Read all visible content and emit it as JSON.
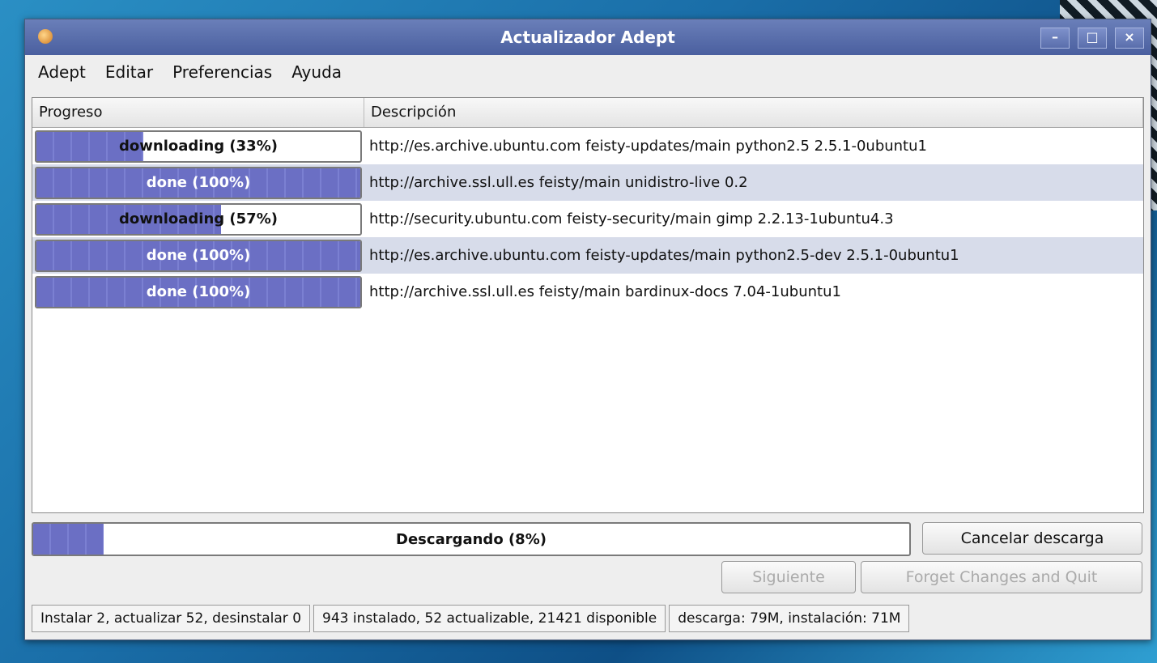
{
  "window": {
    "title": "Actualizador Adept"
  },
  "menu": [
    {
      "label": "Adept"
    },
    {
      "label": "Editar"
    },
    {
      "label": "Preferencias"
    },
    {
      "label": "Ayuda"
    }
  ],
  "list": {
    "headers": [
      "Progreso",
      "Descripción"
    ],
    "rows": [
      {
        "progress_label": "downloading (33%)",
        "progress": 0.33,
        "description": "http://es.archive.ubuntu.com feisty-updates/main python2.5 2.5.1-0ubuntu1"
      },
      {
        "progress_label": "done (100%)",
        "progress": 1.0,
        "description": "http://archive.ssl.ull.es feisty/main unidistro-live 0.2"
      },
      {
        "progress_label": "downloading (57%)",
        "progress": 0.57,
        "description": "http://security.ubuntu.com feisty-security/main gimp 2.2.13-1ubuntu4.3"
      },
      {
        "progress_label": "done (100%)",
        "progress": 1.0,
        "description": "http://es.archive.ubuntu.com feisty-updates/main python2.5-dev 2.5.1-0ubuntu1"
      },
      {
        "progress_label": "done (100%)",
        "progress": 1.0,
        "description": "http://archive.ssl.ull.es feisty/main bardinux-docs 7.04-1ubuntu1"
      }
    ]
  },
  "overall": {
    "label": "Descargando (8%)",
    "progress": 0.08
  },
  "buttons": {
    "cancel": "Cancelar descarga",
    "next": "Siguiente",
    "forget": "Forget Changes and Quit"
  },
  "status": [
    "Instalar 2, actualizar 52, desinstalar 0",
    "943 instalado, 52 actualizable, 21421 disponible",
    "descarga: 79M, instalación: 71M"
  ],
  "colors": {
    "titlebar": "#5a6eac",
    "progress_fill": "#6b6fc4",
    "row_alt": "#d7dcea"
  }
}
